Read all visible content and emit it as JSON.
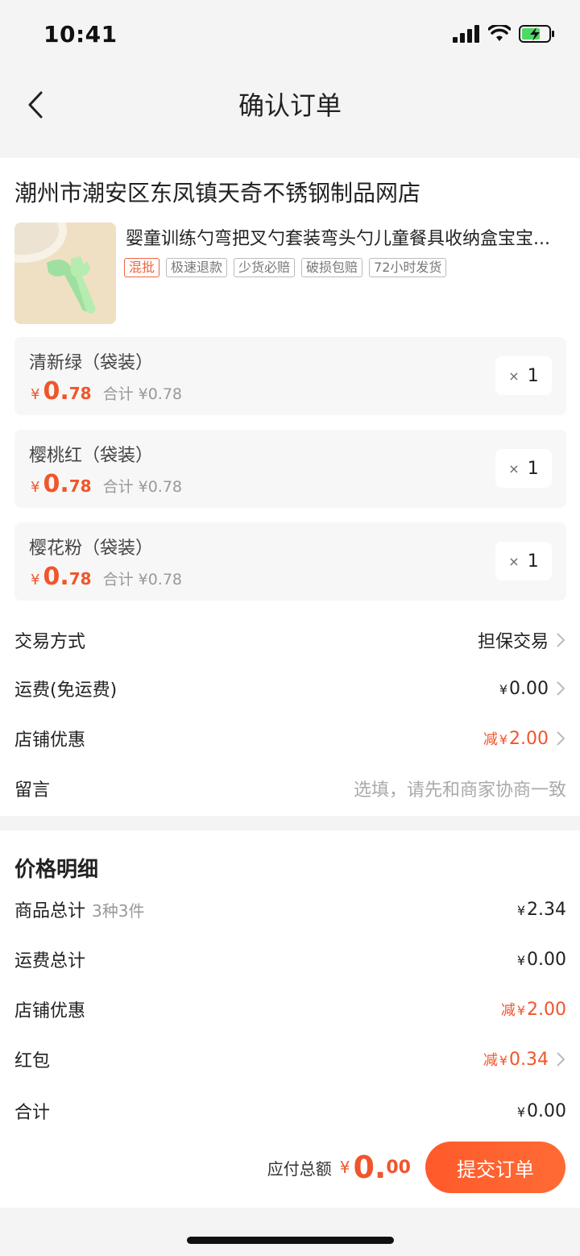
{
  "status": {
    "time": "10:41"
  },
  "nav": {
    "title": "确认订单"
  },
  "shop": {
    "name": "潮州市潮安区东凤镇天奇不锈钢制品网店"
  },
  "product": {
    "title": "婴童训练勺弯把叉勺套装弯头勺儿童餐具收纳盒宝宝...",
    "tags": [
      "混批",
      "极速退款",
      "少货必赔",
      "破损包赔",
      "72小时发货"
    ]
  },
  "skus": [
    {
      "name": "清新绿（袋装）",
      "yen": "¥",
      "price_int": "0.",
      "price_dec": "78",
      "subtotal": "合计 ¥0.78",
      "qty_x": "×",
      "qty": "1"
    },
    {
      "name": "樱桃红（袋装）",
      "yen": "¥",
      "price_int": "0.",
      "price_dec": "78",
      "subtotal": "合计 ¥0.78",
      "qty_x": "×",
      "qty": "1"
    },
    {
      "name": "樱花粉（袋装）",
      "yen": "¥",
      "price_int": "0.",
      "price_dec": "78",
      "subtotal": "合计 ¥0.78",
      "qty_x": "×",
      "qty": "1"
    }
  ],
  "order_options": {
    "trade_label": "交易方式",
    "trade_value": "担保交易",
    "shipping_label": "运费(免运费)",
    "shipping_yen": "¥",
    "shipping_value": "0.00",
    "discount_label": "店铺优惠",
    "discount_prefix": "减",
    "discount_yen": "¥",
    "discount_value": "2.00",
    "note_label": "留言",
    "note_placeholder": "选填，请先和商家协商一致"
  },
  "price_detail": {
    "title": "价格明细",
    "goods_label": "商品总计",
    "goods_sub": "3种3件",
    "goods_yen": "¥",
    "goods_value": "2.34",
    "freight_label": "运费总计",
    "freight_yen": "¥",
    "freight_value": "0.00",
    "shop_disc_label": "店铺优惠",
    "shop_disc_prefix": "减",
    "shop_disc_yen": "¥",
    "shop_disc_value": "2.00",
    "redpack_label": "红包",
    "redpack_prefix": "减",
    "redpack_yen": "¥",
    "redpack_value": "0.34",
    "total_label": "合计",
    "total_yen": "¥",
    "total_value": "0.00"
  },
  "footer": {
    "payable_label": "应付总额",
    "payable_yen": "¥",
    "payable_int": "0.",
    "payable_dec": "00",
    "submit_label": "提交订单"
  },
  "colors": {
    "accent": "#f0552b",
    "button": "#ff5a2b"
  }
}
